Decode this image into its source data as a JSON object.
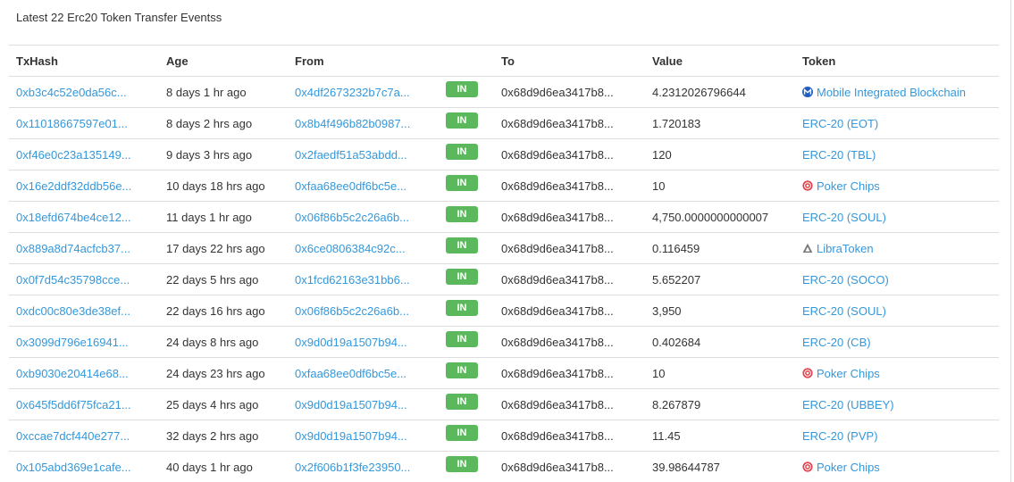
{
  "title": "Latest 22 Erc20 Token Transfer Eventss",
  "colors": {
    "link": "#3498db",
    "in_badge": "#5cb85c",
    "row_border": "#dddddd"
  },
  "columns": {
    "txhash": "TxHash",
    "age": "Age",
    "from": "From",
    "to": "To",
    "value": "Value",
    "token": "Token"
  },
  "rows": [
    {
      "txhash": "0xb3c4c52e0da56c...",
      "age": "8 days 1 hr ago",
      "from": "0x4df2673232b7c7a...",
      "direction": "IN",
      "to": "0x68d9d6ea3417b8...",
      "value": "4.2312026796644",
      "token": "Mobile Integrated Blockchain",
      "token_icon": "mobile-integrated-blockchain-icon"
    },
    {
      "txhash": "0x11018667597e01...",
      "age": "8 days 2 hrs ago",
      "from": "0x8b4f496b82b0987...",
      "direction": "IN",
      "to": "0x68d9d6ea3417b8...",
      "value": "1.720183",
      "token": "ERC-20 (EOT)",
      "token_icon": ""
    },
    {
      "txhash": "0xf46e0c23a135149...",
      "age": "9 days 3 hrs ago",
      "from": "0x2faedf51a53abdd...",
      "direction": "IN",
      "to": "0x68d9d6ea3417b8...",
      "value": "120",
      "token": "ERC-20 (TBL)",
      "token_icon": ""
    },
    {
      "txhash": "0x16e2ddf32ddb56e...",
      "age": "10 days 18 hrs ago",
      "from": "0xfaa68ee0df6bc5e...",
      "direction": "IN",
      "to": "0x68d9d6ea3417b8...",
      "value": "10",
      "token": "Poker Chips",
      "token_icon": "poker-chips-icon"
    },
    {
      "txhash": "0x18efd674be4ce12...",
      "age": "11 days 1 hr ago",
      "from": "0x06f86b5c2c26a6b...",
      "direction": "IN",
      "to": "0x68d9d6ea3417b8...",
      "value": "4,750.0000000000007",
      "token": "ERC-20 (SOUL)",
      "token_icon": ""
    },
    {
      "txhash": "0x889a8d74acfcb37...",
      "age": "17 days 22 hrs ago",
      "from": "0x6ce0806384c92c...",
      "direction": "IN",
      "to": "0x68d9d6ea3417b8...",
      "value": "0.116459",
      "token": "LibraToken",
      "token_icon": "libra-token-icon"
    },
    {
      "txhash": "0x0f7d54c35798cce...",
      "age": "22 days 5 hrs ago",
      "from": "0x1fcd62163e31bb6...",
      "direction": "IN",
      "to": "0x68d9d6ea3417b8...",
      "value": "5.652207",
      "token": "ERC-20 (SOCO)",
      "token_icon": ""
    },
    {
      "txhash": "0xdc00c80e3de38ef...",
      "age": "22 days 16 hrs ago",
      "from": "0x06f86b5c2c26a6b...",
      "direction": "IN",
      "to": "0x68d9d6ea3417b8...",
      "value": "3,950",
      "token": "ERC-20 (SOUL)",
      "token_icon": ""
    },
    {
      "txhash": "0x3099d796e16941...",
      "age": "24 days 8 hrs ago",
      "from": "0x9d0d19a1507b94...",
      "direction": "IN",
      "to": "0x68d9d6ea3417b8...",
      "value": "0.402684",
      "token": "ERC-20 (CB)",
      "token_icon": ""
    },
    {
      "txhash": "0xb9030e20414e68...",
      "age": "24 days 23 hrs ago",
      "from": "0xfaa68ee0df6bc5e...",
      "direction": "IN",
      "to": "0x68d9d6ea3417b8...",
      "value": "10",
      "token": "Poker Chips",
      "token_icon": "poker-chips-icon"
    },
    {
      "txhash": "0x645f5dd6f75fca21...",
      "age": "25 days 4 hrs ago",
      "from": "0x9d0d19a1507b94...",
      "direction": "IN",
      "to": "0x68d9d6ea3417b8...",
      "value": "8.267879",
      "token": "ERC-20 (UBBEY)",
      "token_icon": ""
    },
    {
      "txhash": "0xccae7dcf440e277...",
      "age": "32 days 2 hrs ago",
      "from": "0x9d0d19a1507b94...",
      "direction": "IN",
      "to": "0x68d9d6ea3417b8...",
      "value": "11.45",
      "token": "ERC-20 (PVP)",
      "token_icon": ""
    },
    {
      "txhash": "0x105abd369e1cafe...",
      "age": "40 days 1 hr ago",
      "from": "0x2f606b1f3fe23950...",
      "direction": "IN",
      "to": "0x68d9d6ea3417b8...",
      "value": "39.98644787",
      "token": "Poker Chips",
      "token_icon": "poker-chips-icon"
    }
  ]
}
